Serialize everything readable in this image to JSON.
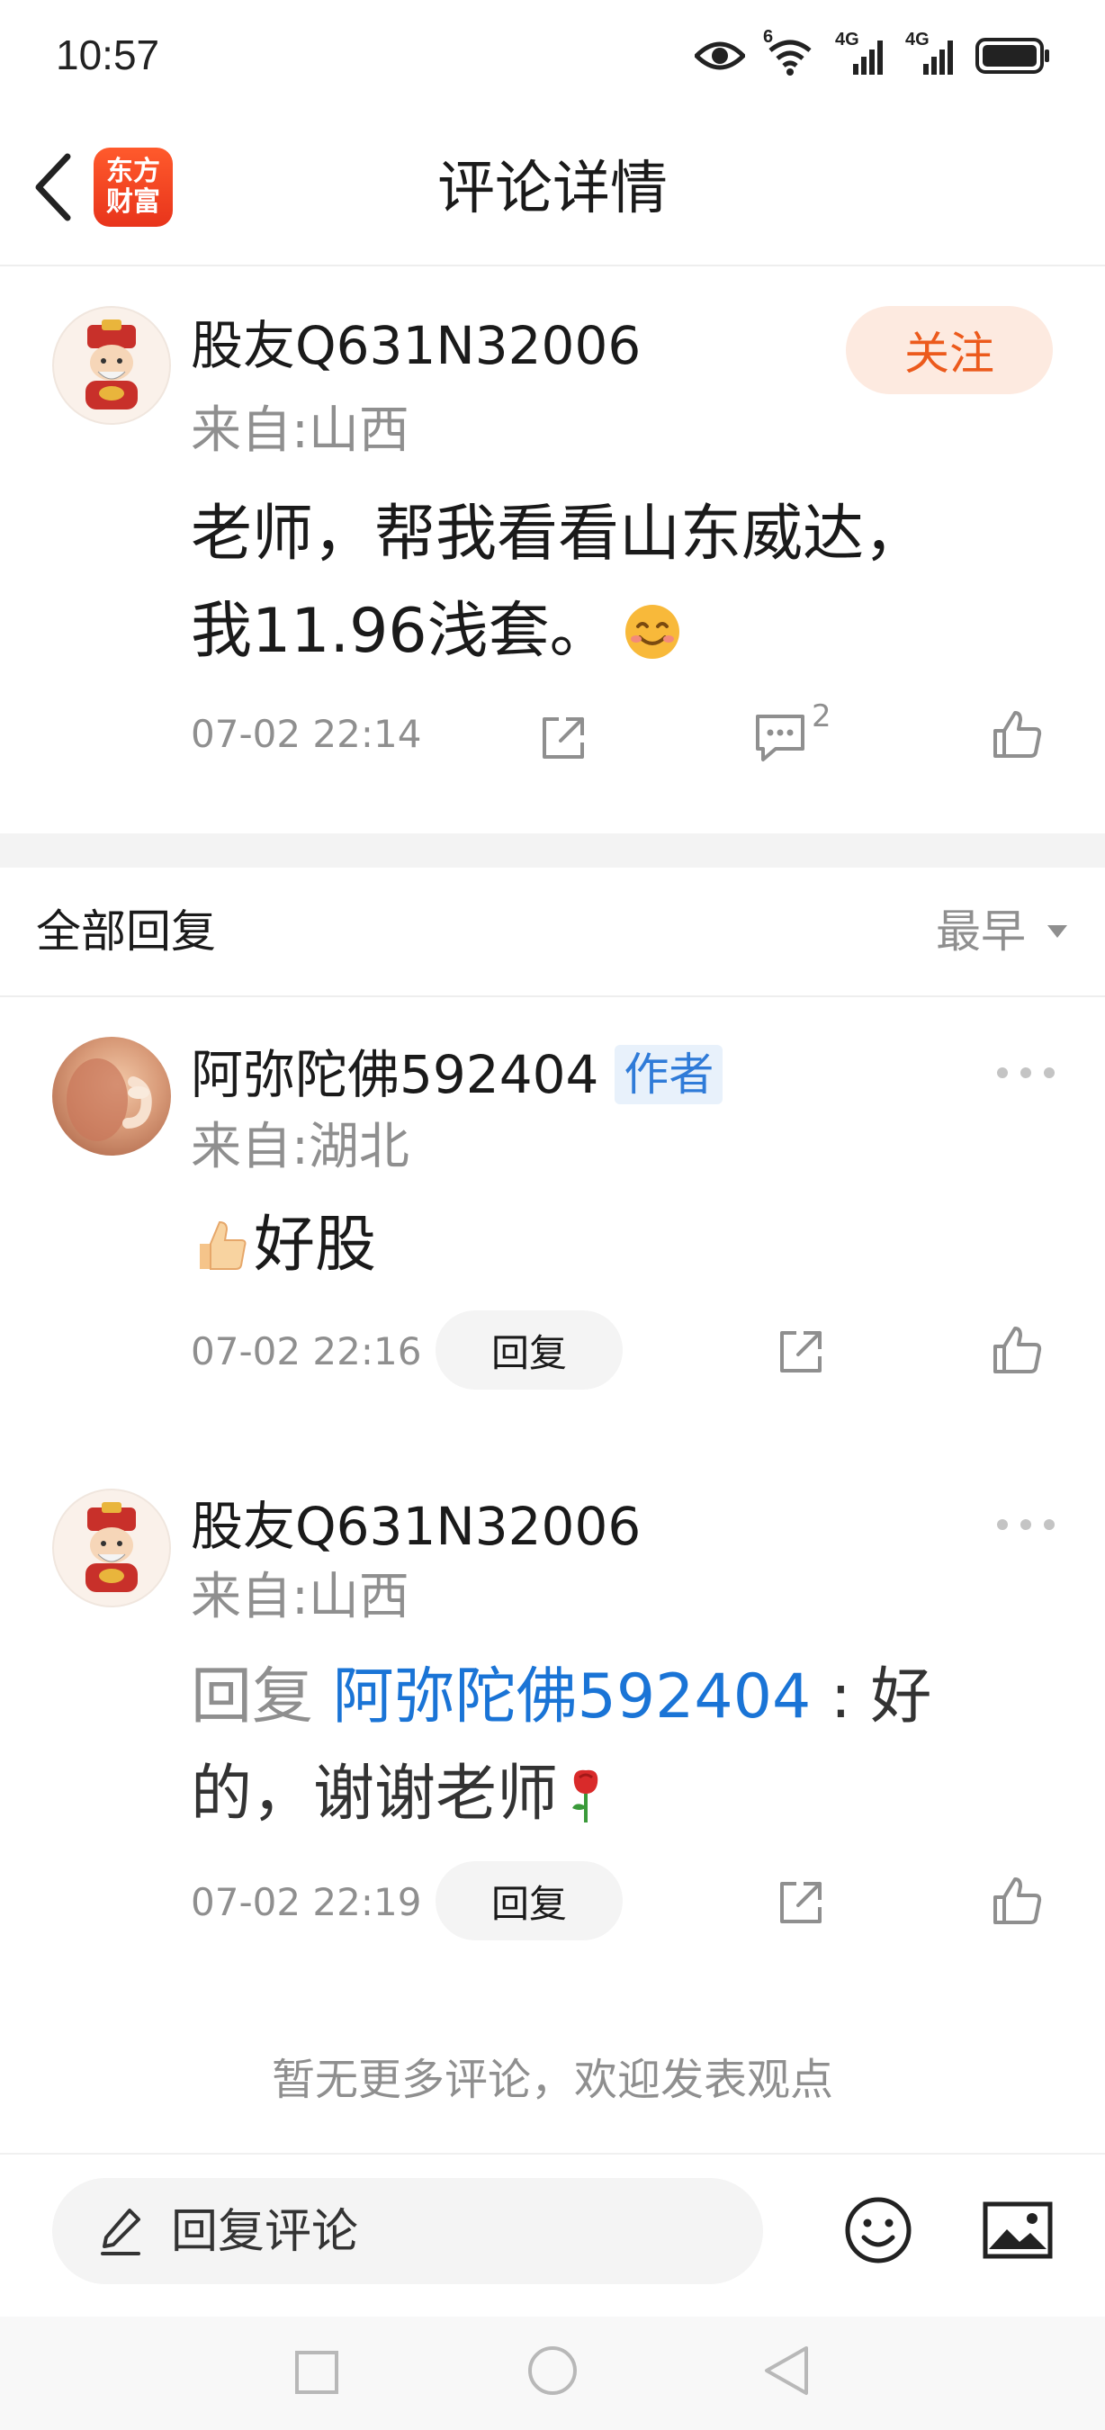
{
  "status_bar": {
    "time": "10:57",
    "icons": [
      "eye-icon",
      "wifi-icon",
      "signal-4g-icon",
      "signal-4g-icon",
      "battery-icon"
    ],
    "signal_labels": [
      "4G",
      "4G"
    ],
    "wifi_label": "6"
  },
  "header": {
    "title": "评论详情",
    "logo_text": "东方财富"
  },
  "post": {
    "username": "股友Q631N32006",
    "location": "来自:山西",
    "follow_label": "关注",
    "content_line1": "老师，帮我看看山东威达，",
    "content_line2": "我11.96浅套。",
    "timestamp": "07-02 22:14",
    "comment_count": "2"
  },
  "replies_section": {
    "title": "全部回复",
    "sort_label": "最早"
  },
  "replies": [
    {
      "username": "阿弥陀佛592404",
      "badge": "作者",
      "location": "来自:湖北",
      "content": "好股",
      "timestamp": "07-02 22:16",
      "reply_label": "回复"
    },
    {
      "username": "股友Q631N32006",
      "location": "来自:山西",
      "reply_prefix": "回复",
      "reply_to": "阿弥陀佛592404",
      "separator": " : ",
      "content_a": "好",
      "content_b": "的，谢谢老师",
      "timestamp": "07-02 22:19",
      "reply_label": "回复"
    }
  ],
  "footer_note": "暂无更多评论，欢迎发表观点",
  "bottom_bar": {
    "placeholder": "回复评论"
  },
  "colors": {
    "accent_orange": "#ec5a1c",
    "link_blue": "#1a74d6",
    "text_gray": "#8f8f8f"
  }
}
